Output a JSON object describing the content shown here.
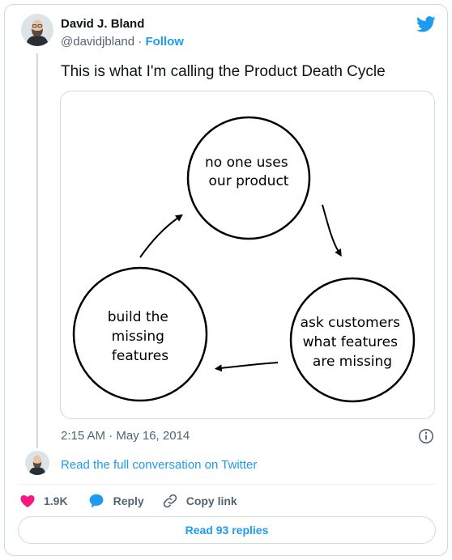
{
  "author": {
    "name": "David J. Bland",
    "handle": "@davidjbland",
    "separator": "·",
    "follow_label": "Follow"
  },
  "tweet": {
    "text": "This is what I'm calling the Product Death Cycle",
    "timestamp": "2:15 AM · May 16, 2014"
  },
  "diagram": {
    "top_circle": [
      "no one uses",
      "our product"
    ],
    "right_circle": [
      "ask customers",
      "what features",
      "are missing"
    ],
    "left_circle": [
      "build the",
      "missing",
      "features"
    ]
  },
  "conversation_link": "Read the full conversation on Twitter",
  "actions": {
    "like_count": "1.9K",
    "reply_label": "Reply",
    "copy_link_label": "Copy link"
  },
  "read_replies_label": "Read 93 replies",
  "colors": {
    "accent": "#1d9bf0",
    "like": "#f91880",
    "text_secondary": "#536471",
    "border": "#cfd9de"
  }
}
